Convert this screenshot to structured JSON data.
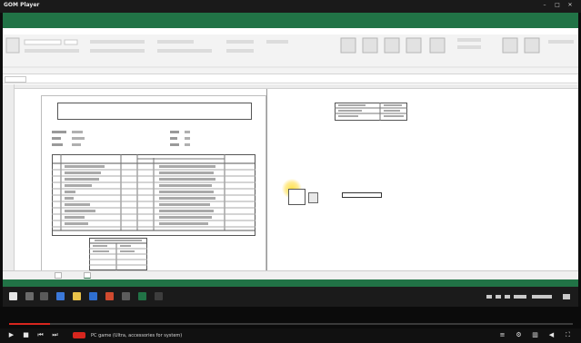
{
  "window": {
    "app_title": "GOM Player",
    "document_title": "",
    "controls": [
      "–",
      "□",
      "✕"
    ]
  },
  "excel": {
    "menu_tabs": [
      "",
      "",
      "",
      "",
      "",
      "",
      "",
      "",
      ""
    ],
    "sheet_title_line1": "",
    "sheet_title_line2": "",
    "sheet_tabs": [
      "",
      ""
    ],
    "colors": {
      "accent": "#217346"
    }
  },
  "player": {
    "caption_highlight": "",
    "caption_rest": "PC game (Ultra, accessories for system)",
    "colors": {
      "progress": "#d7261e"
    }
  }
}
